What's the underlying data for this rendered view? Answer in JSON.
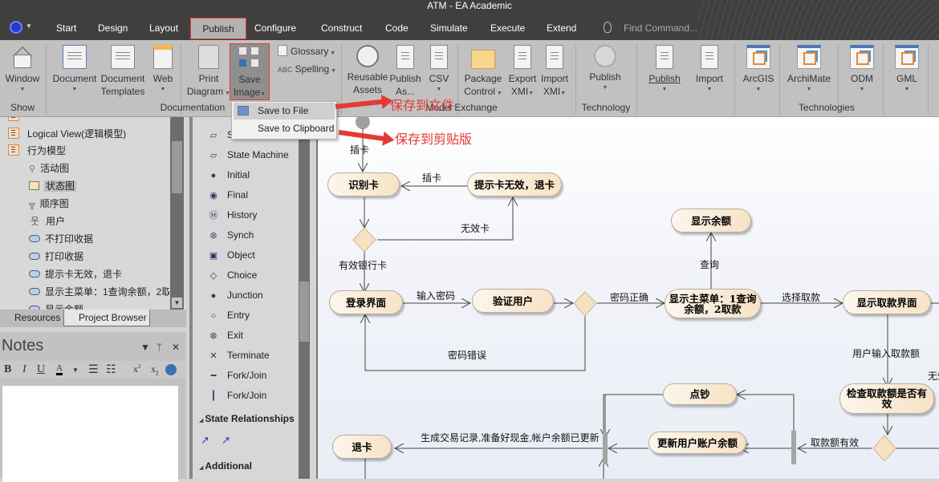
{
  "window": {
    "title": "ATM - EA Academic"
  },
  "menu": {
    "tabs": [
      "Start",
      "Design",
      "Layout",
      "Publish",
      "Configure",
      "Construct",
      "Code",
      "Simulate",
      "Execute",
      "Extend"
    ],
    "active_tab": "Publish",
    "find_placeholder": "Find Command..."
  },
  "ribbon": {
    "show": {
      "window": "Window",
      "group": "Show"
    },
    "documentation": {
      "document": "Document",
      "document_templates_1": "Document",
      "document_templates_2": "Templates",
      "web": "Web",
      "print_1": "Print",
      "print_2": "Diagram",
      "save_1": "Save",
      "save_2": "Image",
      "glossary": "Glossary",
      "spelling": "Spelling",
      "group": "Documentation"
    },
    "model_exchange": {
      "reusable_1": "Reusable",
      "reusable_2": "Assets",
      "publish_as_1": "Publish",
      "publish_as_2": "As...",
      "csv": "CSV",
      "package_1": "Package",
      "package_2": "Control",
      "export_1": "Export",
      "export_2": "XMI",
      "import_1": "Import",
      "import_2": "XMI",
      "group": "Model Exchange"
    },
    "technology": {
      "publish": "Publish",
      "group": "Technology"
    },
    "technologies": {
      "publish": "Publish",
      "import": "Import",
      "arcgis": "ArcGIS",
      "archimate": "ArchiMate",
      "odm": "ODM",
      "gml": "GML",
      "group": "Technologies"
    }
  },
  "save_image_menu": {
    "items": [
      "Save to File",
      "Save to Clipboard"
    ],
    "highlighted": "Save to File"
  },
  "annotations": {
    "save_file": "保存到文件",
    "save_clipboard": "保存到剪贴版"
  },
  "project_browser": {
    "items": [
      {
        "label": "Logical View(逻辑模型)",
        "type": "package"
      },
      {
        "label": "行为模型",
        "type": "package"
      },
      {
        "label": "活动图",
        "type": "activity-diagram"
      },
      {
        "label": "状态图",
        "type": "state-diagram",
        "selected": true
      },
      {
        "label": "顺序图",
        "type": "sequence-diagram"
      },
      {
        "label": "用户",
        "type": "actor"
      },
      {
        "label": "不打印收据",
        "type": "state"
      },
      {
        "label": "打印收据",
        "type": "state"
      },
      {
        "label": "提示卡无效，退卡",
        "type": "state"
      },
      {
        "label": "显示主菜单：1查询余额，2取",
        "type": "state"
      },
      {
        "label": "显示余额",
        "type": "state"
      }
    ],
    "tabs": [
      "Resources",
      "Project Browser"
    ],
    "active_tab": "Project Browser"
  },
  "notes": {
    "title": "Notes",
    "toolbar": [
      "B",
      "I",
      "U"
    ],
    "content": ""
  },
  "toolbox": {
    "items": [
      "State",
      "State Machine",
      "Initial",
      "Final",
      "History",
      "Synch",
      "Object",
      "Choice",
      "Junction",
      "Entry",
      "Exit",
      "Terminate",
      "Fork/Join",
      "Fork/Join"
    ],
    "sections": [
      "State Relationships",
      "Additional"
    ]
  },
  "diagram": {
    "states": {
      "identify_card": "识别卡",
      "invalid_card": "提示卡无效，退卡",
      "show_balance": "显示余额",
      "login": "登录界面",
      "verify_user": "验证用户",
      "main_menu": "显示主菜单：1查询余额，2取款",
      "withdraw_screen": "显示取款界面",
      "check_amount": "检查取款额是否有效",
      "count_cash": "点钞",
      "update_balance": "更新用户账户余额",
      "eject_card": "退卡"
    },
    "transitions": {
      "insert_card_1": "插卡",
      "insert_card_2": "插卡",
      "invalid_card": "无效卡",
      "valid_card": "有效银行卡",
      "enter_pwd": "输入密码",
      "pwd_correct": "密码正确",
      "pwd_wrong": "密码错误",
      "query": "查询",
      "choose_withdraw": "选择取款",
      "enter_amount": "用户输入取款额",
      "amount_valid": "取款额有效",
      "invalid_partial": "无效",
      "done": "生成交易记录,准备好现金,帐户余额已更新"
    }
  }
}
